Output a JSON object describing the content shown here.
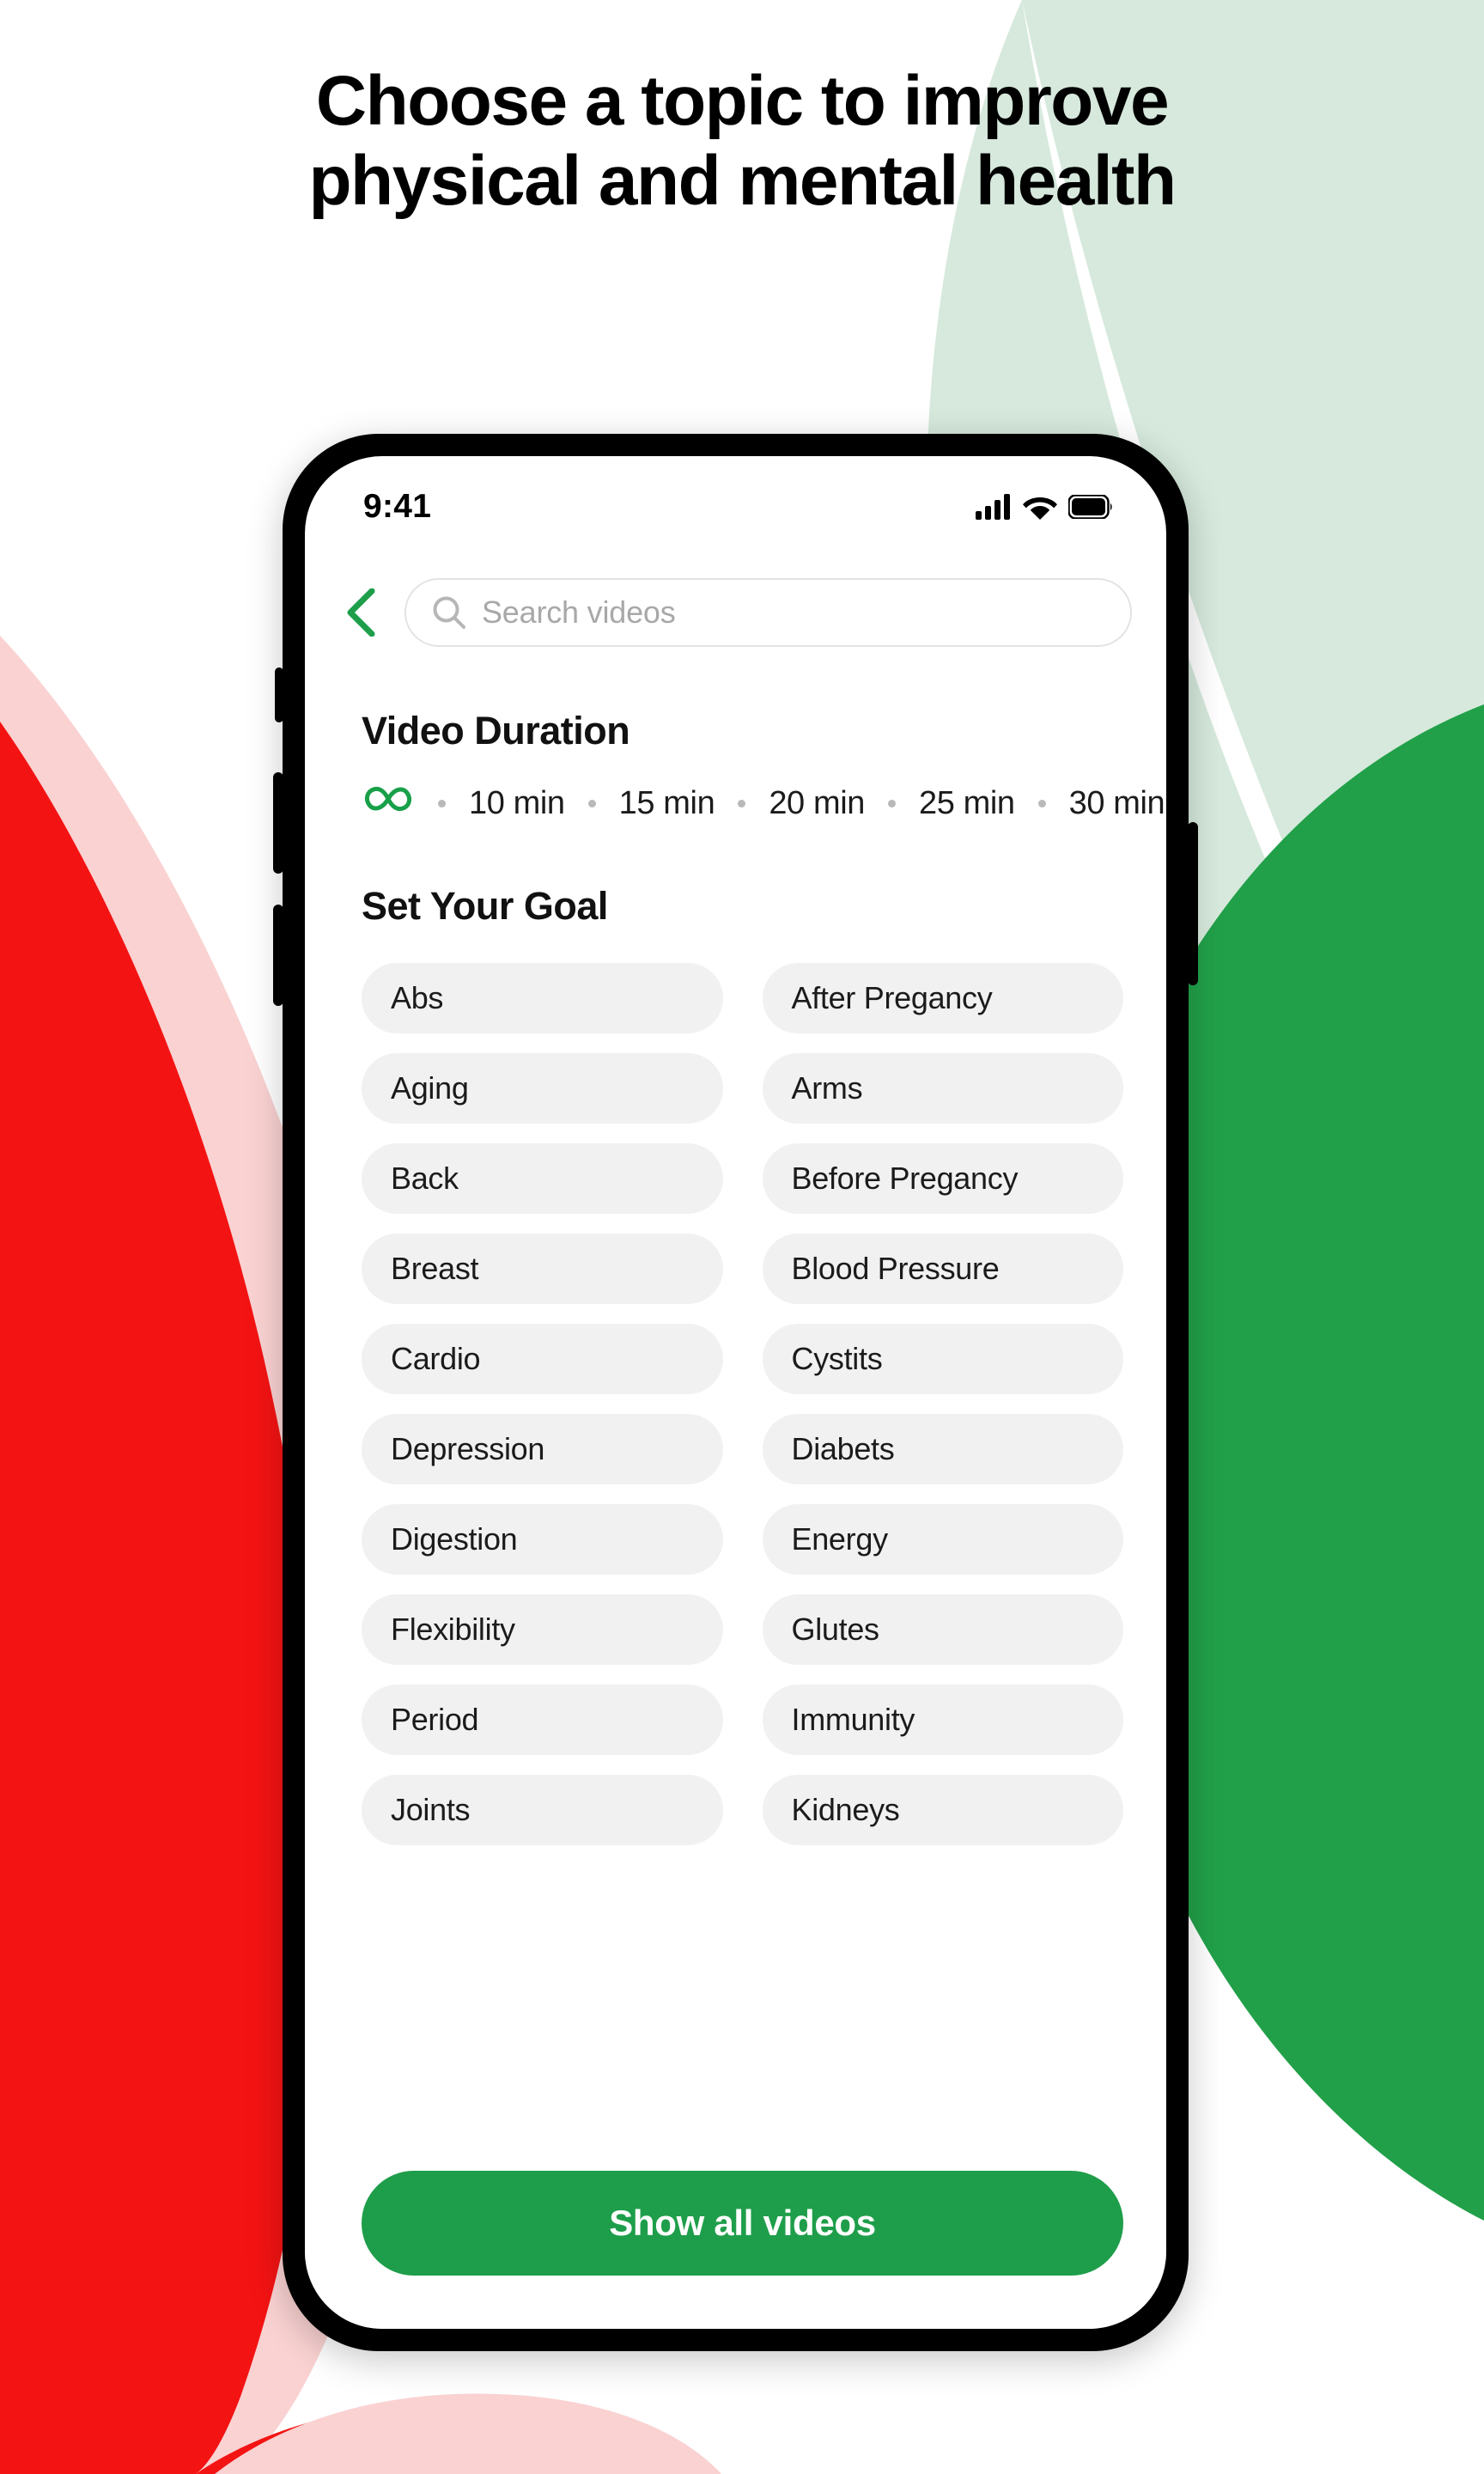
{
  "headline": {
    "line1": "Choose a topic to improve",
    "line2": "physical and mental health"
  },
  "colors": {
    "brand_green": "#1E9E4A",
    "accent_green": "#21A049",
    "light_green": "#D6E9DC",
    "red": "#F41313",
    "light_pink": "#FAD2D2",
    "chip_bg": "#F1F1F1",
    "page_bg": "#FFFFFF"
  },
  "phone": {
    "statusbar": {
      "time": "9:41",
      "icons": [
        "cellular-signal-icon",
        "wifi-icon",
        "battery-icon"
      ]
    },
    "header": {
      "back_icon": "chevron-left-icon",
      "search": {
        "icon": "search-icon",
        "value": "",
        "placeholder": "Search videos"
      }
    },
    "duration": {
      "title": "Video Duration",
      "options": [
        {
          "label": "∞",
          "icon": "infinity-icon",
          "selected": true
        },
        {
          "label": "10 min",
          "selected": false
        },
        {
          "label": "15 min",
          "selected": false
        },
        {
          "label": "20 min",
          "selected": false
        },
        {
          "label": "25 min",
          "selected": false
        },
        {
          "label": "30 min",
          "selected": false
        }
      ]
    },
    "goals": {
      "title": "Set Your Goal",
      "chips": [
        "Abs",
        "After Pregancy",
        "Aging",
        "Arms",
        "Back",
        "Before Pregancy",
        "Breast",
        "Blood Pressure",
        "Cardio",
        "Cystits",
        "Depression",
        "Diabets",
        "Digestion",
        "Energy",
        "Flexibility",
        "Glutes",
        "Period",
        "Immunity",
        "Joints",
        "Kidneys"
      ]
    },
    "cta": {
      "label": "Show all videos"
    }
  }
}
